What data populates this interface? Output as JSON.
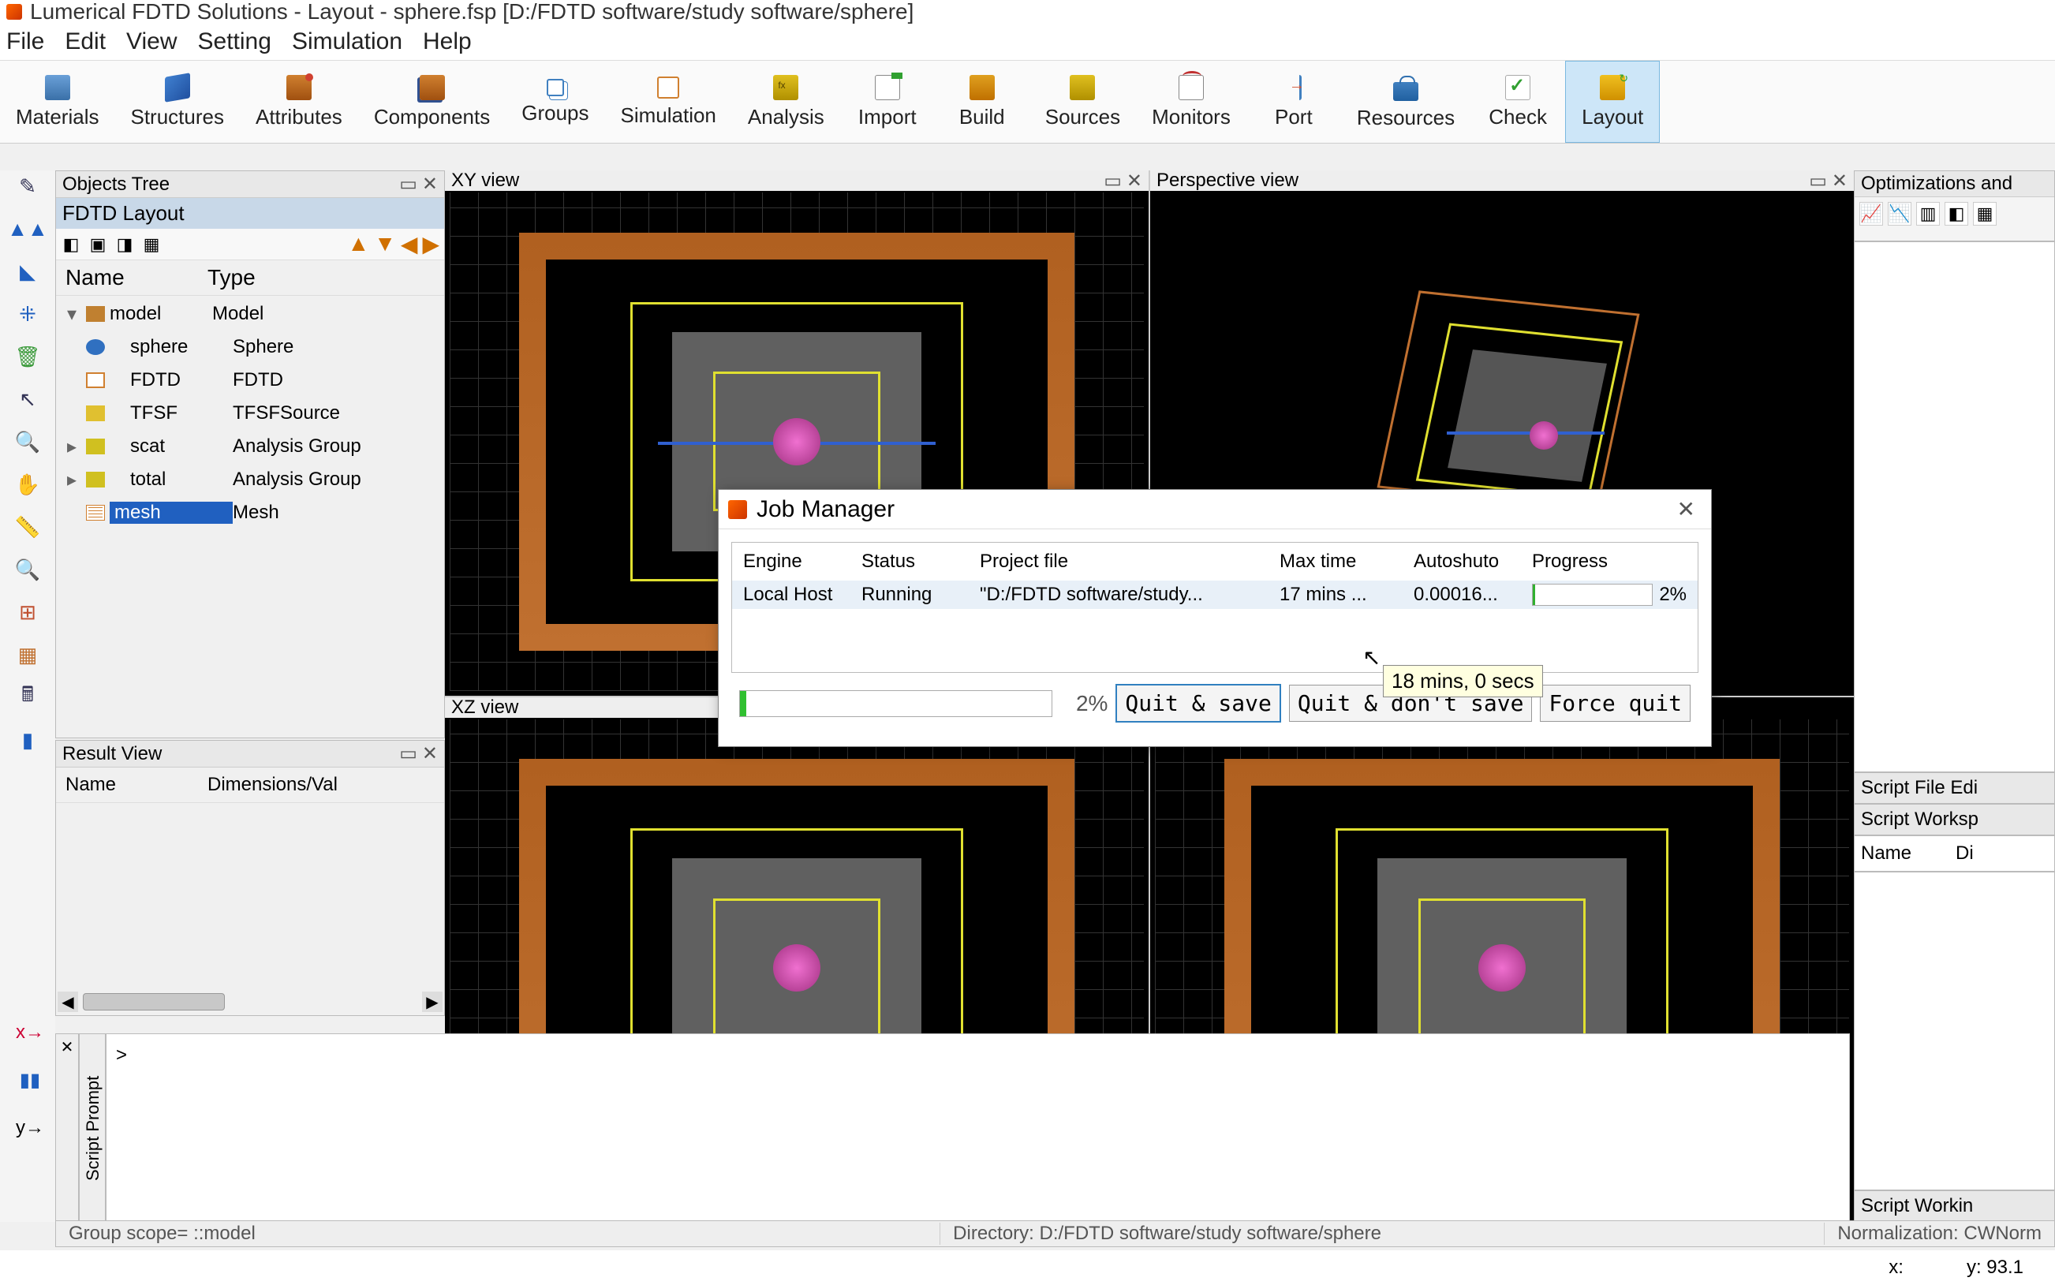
{
  "window": {
    "title": "Lumerical FDTD Solutions - Layout - sphere.fsp [D:/FDTD software/study software/sphere]"
  },
  "menu": {
    "file": "File",
    "edit": "Edit",
    "view": "View",
    "setting": "Setting",
    "simulation": "Simulation",
    "help": "Help"
  },
  "toolbar": {
    "materials": "Materials",
    "structures": "Structures",
    "attributes": "Attributes",
    "components": "Components",
    "groups": "Groups",
    "simulation": "Simulation",
    "analysis": "Analysis",
    "import": "Import",
    "build": "Build",
    "sources": "Sources",
    "monitors": "Monitors",
    "port": "Port",
    "resources": "Resources",
    "check": "Check",
    "layout": "Layout"
  },
  "panels": {
    "objects_tree": "Objects Tree",
    "fdtd_layout": "FDTD Layout",
    "result_view": "Result View",
    "xy_view": "XY view",
    "perspective_view": "Perspective view",
    "xz_view": "XZ view",
    "optimizations": "Optimizations and",
    "script_editor": "Script File Edi",
    "script_workspace": "Script Worksp",
    "script_prompt": "Script Prompt",
    "script_working": "Script Workin"
  },
  "tree": {
    "col_name": "Name",
    "col_type": "Type",
    "rows": [
      {
        "name": "model",
        "type": "Model"
      },
      {
        "name": "sphere",
        "type": "Sphere"
      },
      {
        "name": "FDTD",
        "type": "FDTD"
      },
      {
        "name": "TFSF",
        "type": "TFSFSource"
      },
      {
        "name": "scat",
        "type": "Analysis Group"
      },
      {
        "name": "total",
        "type": "Analysis Group"
      },
      {
        "name": "mesh",
        "type": "Mesh"
      }
    ]
  },
  "result": {
    "col_name": "Name",
    "col_dims": "Dimensions/Val"
  },
  "workspace": {
    "col_name": "Name",
    "col_di": "Di"
  },
  "job_manager": {
    "title": "Job Manager",
    "cols": {
      "engine": "Engine",
      "status": "Status",
      "project": "Project file",
      "max": "Max time",
      "auto": "Autoshuto",
      "prog": "Progress"
    },
    "row": {
      "engine": "Local Host",
      "status": "Running",
      "project": "\"D:/FDTD software/study...",
      "max": "17 mins ...",
      "auto": "0.00016...",
      "prog": "2%"
    },
    "tooltip": "18 mins, 0 secs",
    "footer_pct": "2%",
    "btn_qs": "Quit & save",
    "btn_qd": "Quit & don't save",
    "btn_fq": "Force quit"
  },
  "prompt": {
    "cursor": ">"
  },
  "status": {
    "scope": "Group scope= ::model",
    "dir": "Directory:  D:/FDTD software/study software/sphere",
    "norm": "Normalization:  CWNorm"
  },
  "footer": {
    "x": "x:",
    "y": "y: 93.1"
  }
}
